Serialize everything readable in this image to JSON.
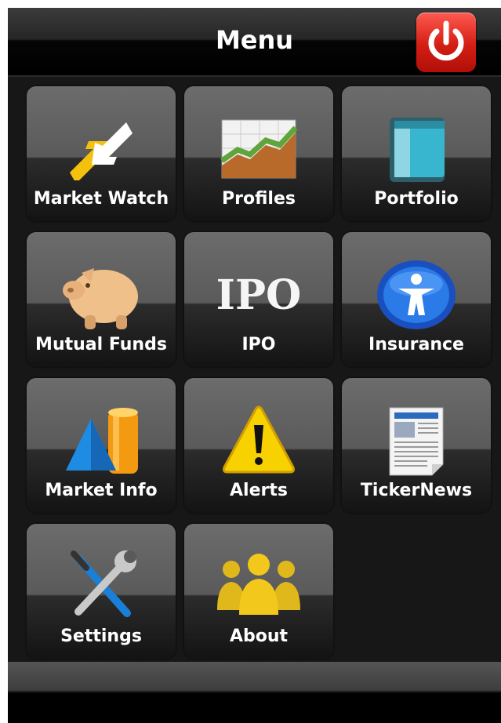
{
  "header": {
    "title": "Menu",
    "power_icon": "power-icon",
    "power_color": "#d41e14"
  },
  "menu": [
    {
      "label": "Market Watch",
      "icon": "arrows-icon"
    },
    {
      "label": "Profiles",
      "icon": "chart-icon"
    },
    {
      "label": "Portfolio",
      "icon": "book-icon"
    },
    {
      "label": "Mutual Funds",
      "icon": "piggy-bank-icon"
    },
    {
      "label": "IPO",
      "icon": "ipo-text-icon",
      "icon_text": "IPO"
    },
    {
      "label": "Insurance",
      "icon": "person-circle-icon"
    },
    {
      "label": "Market Info",
      "icon": "shapes-icon"
    },
    {
      "label": "Alerts",
      "icon": "warning-icon"
    },
    {
      "label": "TickerNews",
      "icon": "newspaper-icon"
    },
    {
      "label": "Settings",
      "icon": "tools-icon"
    },
    {
      "label": "About",
      "icon": "people-icon"
    }
  ]
}
